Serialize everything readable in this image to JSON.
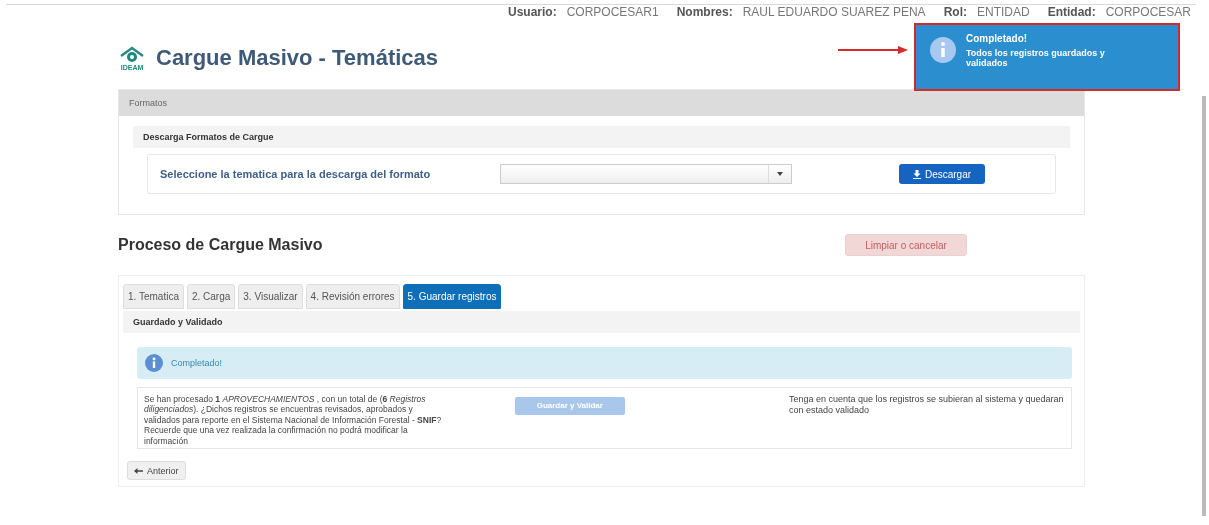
{
  "user_bar": [
    {
      "label": "Usuario:",
      "value": "CORPOCESAR1"
    },
    {
      "label": "Nombres:",
      "value": "RAUL EDUARDO SUAREZ PENA"
    },
    {
      "label": "Rol:",
      "value": "ENTIDAD"
    },
    {
      "label": "Entidad:",
      "value": "CORPOCESAR"
    }
  ],
  "logo_text": "IDEAM",
  "page_title": "Cargue Masivo - Temáticas",
  "toast": {
    "title": "Completado!",
    "message": "Todos los registros guardados y validados",
    "highlighted": true
  },
  "formatos": {
    "header": "Formatos",
    "subheader": "Descarga Formatos de Cargue",
    "label": "Seleccione la tematica para la descarga del formato",
    "button": "Descargar"
  },
  "process": {
    "title": "Proceso de Cargue Masivo",
    "cancel_button": "Limpiar o cancelar",
    "tabs": [
      {
        "label": "1. Tematica",
        "selected": false
      },
      {
        "label": "2. Carga",
        "selected": false
      },
      {
        "label": "3. Visualizar",
        "selected": false
      },
      {
        "label": "4. Revisión errores",
        "selected": false
      },
      {
        "label": "5. Guardar registros",
        "selected": true
      }
    ],
    "subheader": "Guardado y Validado",
    "alert": "Completado!",
    "summary": "Se han procesado **1** *APROVECHAMIENTOS* , con un total de (**6** *Registros diligenciados*). ¿Dichos registros se encuentras revisados, aprobados y validados para reporte en el Sistema Nacional de Información Forestal - **SNIF**? Recuerde que una vez realizada la confirmación no podrá modificar la información",
    "save_button": {
      "label": "Guardar y Validar",
      "disabled": true
    },
    "note": "Tenga en cuenta que los registros se subieran al sistema y quedaran con estado validado",
    "back_button": "Anterior"
  }
}
